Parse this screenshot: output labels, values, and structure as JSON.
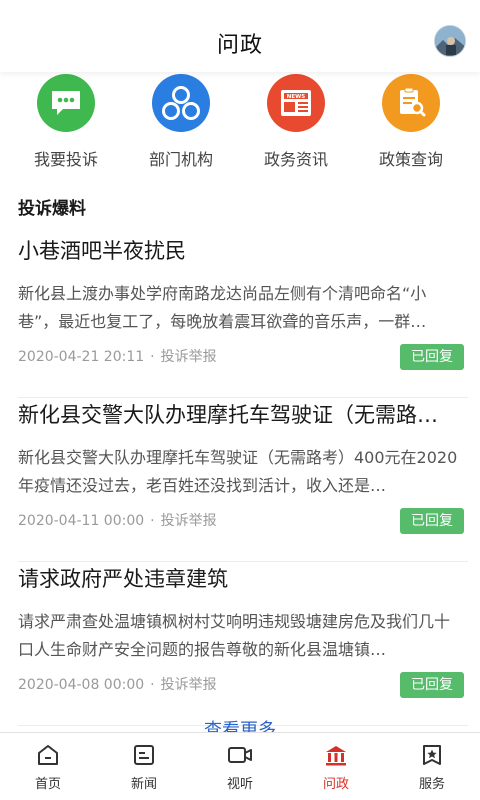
{
  "header": {
    "title": "问政"
  },
  "quick_links": [
    {
      "label": "我要投诉",
      "icon": "chat-bubble-icon",
      "color": "#3fb84f"
    },
    {
      "label": "部门机构",
      "icon": "org-circles-icon",
      "color": "#2a7de1"
    },
    {
      "label": "政务资讯",
      "icon": "news-icon",
      "color": "#e84a2f"
    },
    {
      "label": "政策查询",
      "icon": "document-search-icon",
      "color": "#f29a1f"
    }
  ],
  "section": {
    "title": "投诉爆料"
  },
  "posts": [
    {
      "title": "小巷酒吧半夜扰民",
      "body": "新化县上渡办事处学府南路龙达尚品左侧有个清吧命名“小巷”，最近也复工了，每晚放着震耳欲聋的音乐声，一群…",
      "date": "2020-04-21 20:11",
      "category": "投诉举报",
      "status": "已回复"
    },
    {
      "title": "新化县交警大队办理摩托车驾驶证（无需路…",
      "body": "新化县交警大队办理摩托车驾驶证（无需路考）400元在2020年疫情还没过去，老百姓还没找到活计，收入还是…",
      "date": "2020-04-11 00:00",
      "category": "投诉举报",
      "status": "已回复"
    },
    {
      "title": "请求政府严处违章建筑",
      "body": "请求严肃查处温塘镇枫树村艾响明违规毁塘建房危及我们几十口人生命财产安全问题的报告尊敬的新化县温塘镇…",
      "date": "2020-04-08 00:00",
      "category": "投诉举报",
      "status": "已回复"
    }
  ],
  "more_label": "查看更多",
  "tabs": [
    {
      "label": "首页",
      "icon": "home-icon"
    },
    {
      "label": "新闻",
      "icon": "news-list-icon"
    },
    {
      "label": "视听",
      "icon": "video-camera-icon"
    },
    {
      "label": "问政",
      "icon": "government-building-icon",
      "active": true
    },
    {
      "label": "服务",
      "icon": "service-star-icon"
    }
  ],
  "colors": {
    "accent_red": "#d6302a",
    "badge_green": "#57bb6c",
    "more_blue": "#2a64c6"
  }
}
